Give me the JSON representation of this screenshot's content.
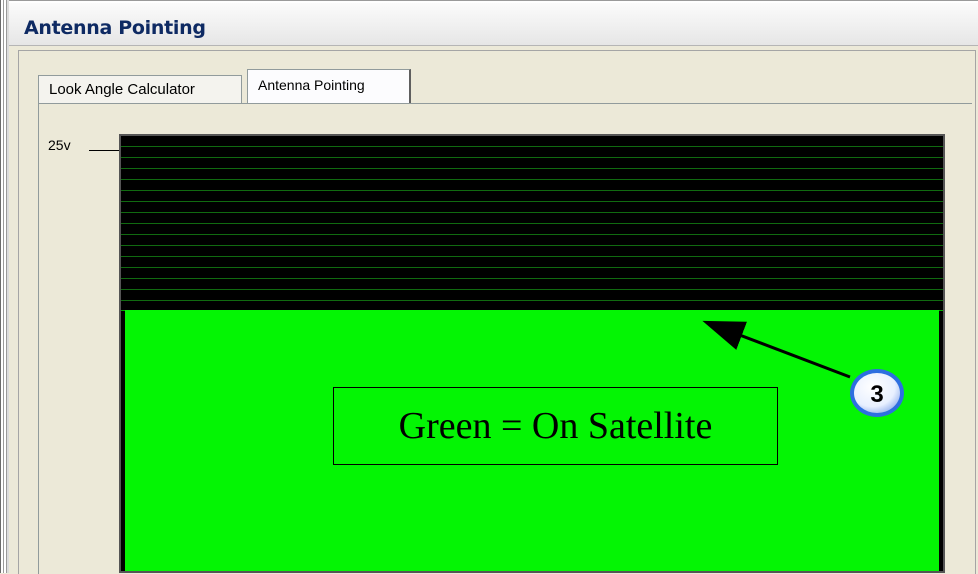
{
  "window": {
    "title": "Antenna Pointing"
  },
  "tabs": [
    {
      "label": "Look Angle Calculator",
      "selected": false
    },
    {
      "label": "Antenna Pointing",
      "selected": true
    }
  ],
  "meter": {
    "top_label": "25v",
    "level_fraction": 0.6,
    "level_color": "#04f504",
    "empty_color": "#000000",
    "grid_color": "#106a10"
  },
  "annotation": {
    "text": "Green = On Satellite",
    "callout_number": "3",
    "callout_color": "#2d6fe0"
  }
}
